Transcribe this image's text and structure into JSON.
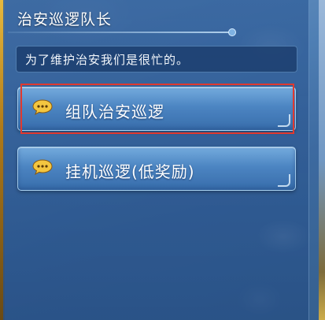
{
  "dialog": {
    "title": "治安巡逻队长",
    "message": "为了维护治安我们是很忙的。"
  },
  "options": [
    {
      "label": "组队治安巡逻",
      "icon": "speech-bubble-icon"
    },
    {
      "label": "挂机巡逻(低奖励)",
      "icon": "speech-bubble-icon"
    }
  ],
  "colors": {
    "highlight": "#e0392f",
    "bubble": "#f3c640",
    "panel": "#36649e"
  }
}
